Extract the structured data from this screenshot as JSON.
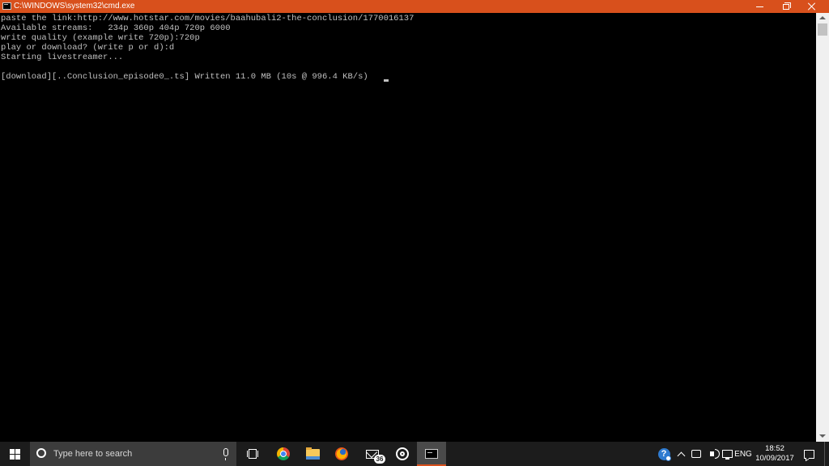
{
  "window": {
    "title": "C:\\WINDOWS\\system32\\cmd.exe"
  },
  "console": {
    "text": "paste the link:http://www.hotstar.com/movies/baahubali2-the-conclusion/1770016137\nAvailable streams:   234p 360p 404p 720p 6000\nwrite quality (example write 720p):720p\nplay or download? (write p or d):d\nStarting livestreamer...\n\n[download][..Conclusion_episode0_.ts] Written 11.0 MB (10s @ 996.4 KB/s)"
  },
  "taskbar": {
    "search_placeholder": "Type here to search",
    "mail_badge": "36",
    "language": "ENG",
    "time": "18:52",
    "date": "10/09/2017",
    "help_glyph": "?"
  },
  "colors": {
    "titlebar": "#d8501c",
    "console_bg": "#000000",
    "console_text": "#c0c0c0",
    "taskbar_bg": "#1c1c1c"
  },
  "icons": [
    "windows-start-icon",
    "search-icon",
    "microphone-icon",
    "task-view-icon",
    "chrome-icon",
    "file-explorer-icon",
    "firefox-icon",
    "mail-icon",
    "groove-music-icon",
    "cmd-icon",
    "help-icon",
    "chevron-up-icon",
    "touch-keyboard-icon",
    "volume-icon",
    "network-icon",
    "notification-icon"
  ]
}
